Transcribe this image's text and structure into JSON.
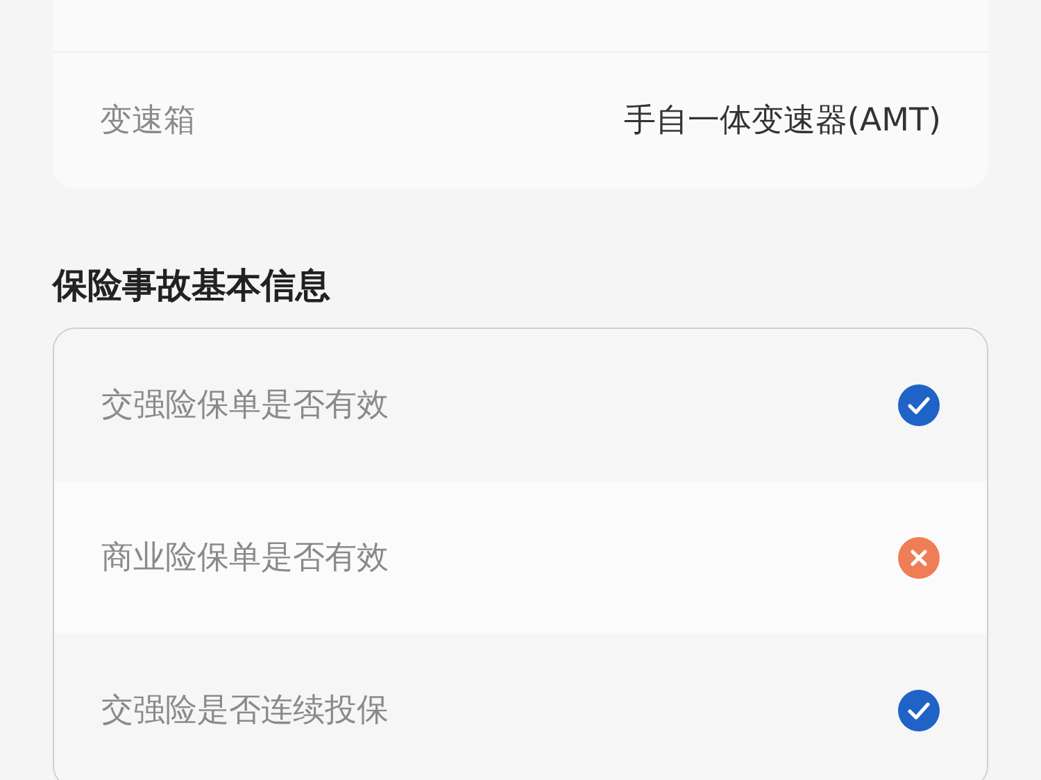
{
  "vehicle_card": {
    "rows": [
      {
        "label": "变速箱",
        "value": "手自一体变速器(AMT)"
      }
    ]
  },
  "accident_section": {
    "title": "保险事故基本信息",
    "rows": [
      {
        "label": "交强险保单是否有效",
        "valid": true
      },
      {
        "label": "商业险保单是否有效",
        "valid": false
      },
      {
        "label": "交强险是否连续投保",
        "valid": true
      }
    ]
  }
}
